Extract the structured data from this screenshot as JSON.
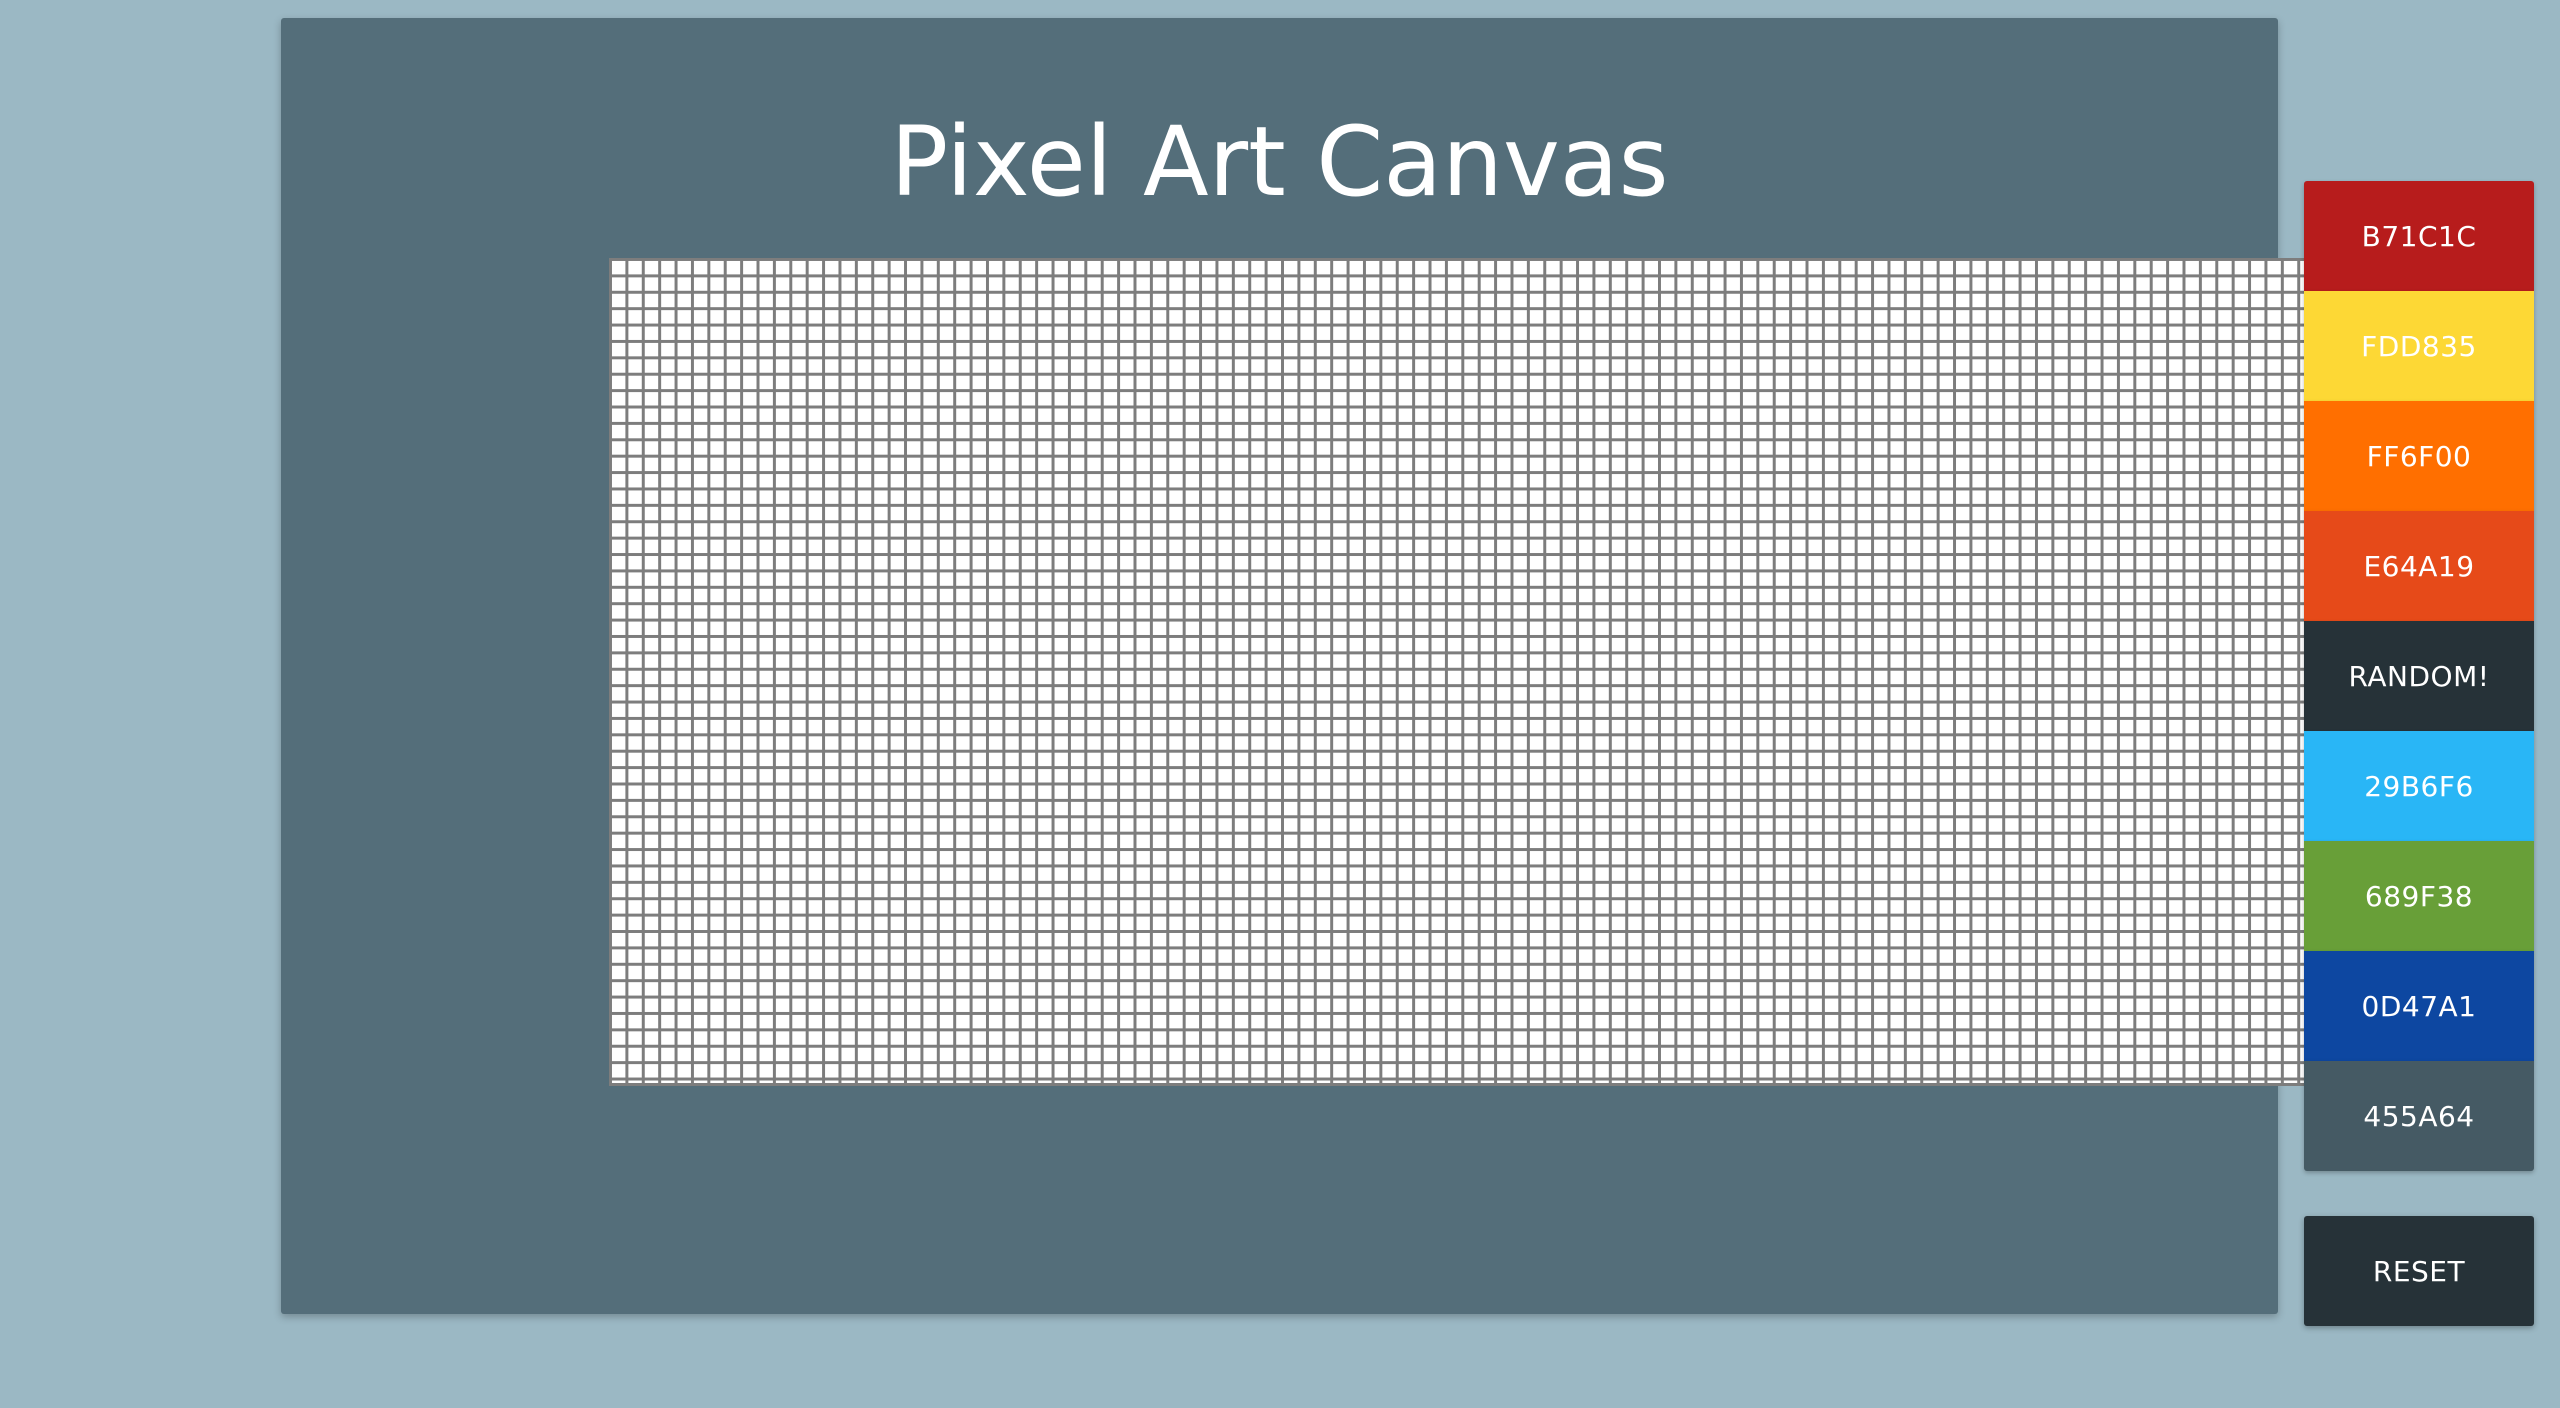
{
  "app": {
    "title": "Pixel Art Canvas"
  },
  "canvas": {
    "background_color": "#ffffff",
    "grid_line_color": "#7d7d7d"
  },
  "palette": [
    {
      "label": "B71C1C",
      "color": "#b71c1c"
    },
    {
      "label": "FDD835",
      "color": "#fdd835"
    },
    {
      "label": "FF6F00",
      "color": "#ff6f00"
    },
    {
      "label": "E64A19",
      "color": "#e64a19"
    },
    {
      "label": "RANDOM!",
      "color": "#263238"
    },
    {
      "label": "29B6F6",
      "color": "#29b6f6"
    },
    {
      "label": "689F38",
      "color": "#689f38"
    },
    {
      "label": "0D47A1",
      "color": "#0d47a1"
    },
    {
      "label": "455A64",
      "color": "#455a64"
    }
  ],
  "controls": {
    "reset_label": "RESET"
  },
  "theme": {
    "page_background": "#9bb8c4",
    "panel_background": "#546e7a"
  }
}
